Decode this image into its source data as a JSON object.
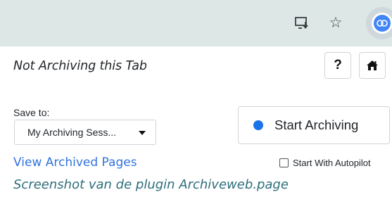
{
  "browser": {
    "icons": [
      "install-icon",
      "star-icon",
      "archiveweb-extension-icon"
    ],
    "accent": "#4285f4"
  },
  "popup": {
    "status": "Not Archiving this Tab",
    "help_label": "?",
    "home_icon": "home-icon",
    "save_to_label": "Save to:",
    "collection_selected": "My Archiving Sess...",
    "start_label": "Start Archiving",
    "start_dot_color": "#1a73e8",
    "view_archived_label": "View Archived Pages",
    "autopilot_label": "Start With Autopilot",
    "autopilot_checked": false
  },
  "caption": "Screenshot van de plugin Archiveweb.page"
}
